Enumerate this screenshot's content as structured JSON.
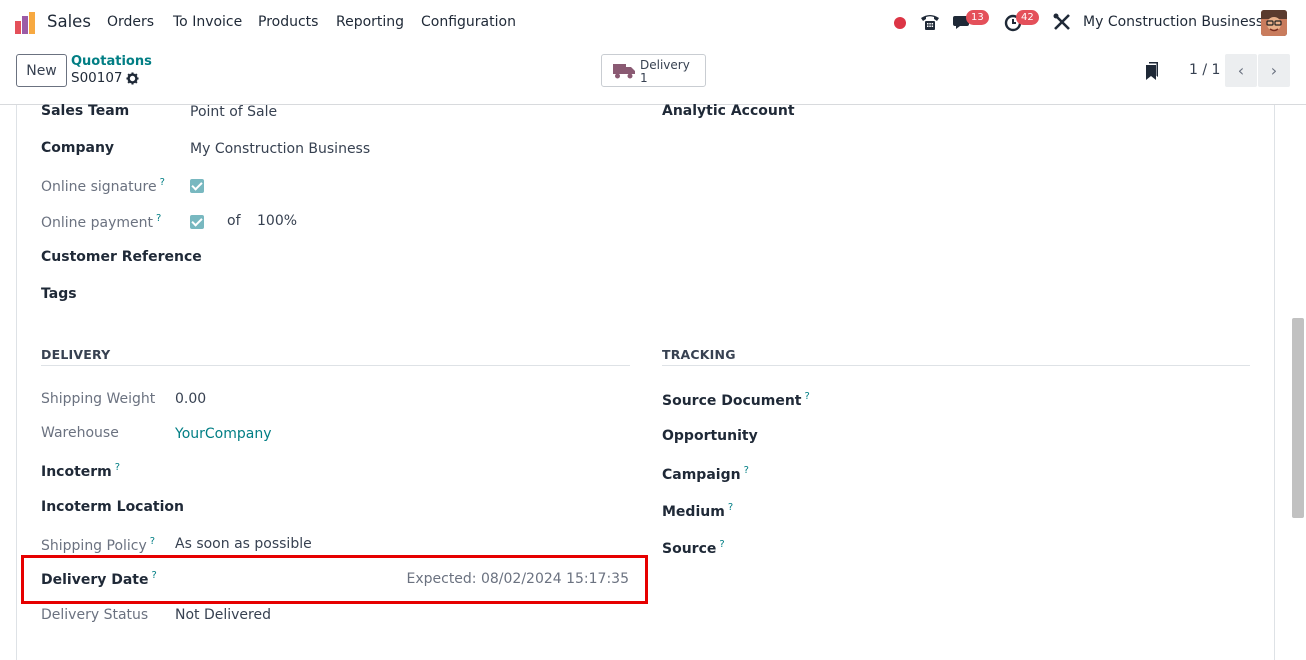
{
  "nav": {
    "app_name": "Sales",
    "menu": [
      "Orders",
      "To Invoice",
      "Products",
      "Reporting",
      "Configuration"
    ],
    "messages_badge": "13",
    "activities_badge": "42",
    "company": "My Construction Business"
  },
  "control": {
    "new_label": "New",
    "breadcrumb_parent": "Quotations",
    "record_name": "S00107",
    "smart_button_label": "Delivery",
    "smart_button_count": "1",
    "pager": "1 / 1"
  },
  "left_fields": {
    "sales_team_label": "Sales Team",
    "sales_team_value": "Point of Sale",
    "company_label": "Company",
    "company_value": "My Construction Business",
    "online_signature_label": "Online signature",
    "online_payment_label": "Online payment",
    "online_payment_of": "of",
    "online_payment_pct": "100%",
    "customer_reference_label": "Customer Reference",
    "tags_label": "Tags"
  },
  "right_fields": {
    "analytic_account_label": "Analytic Account"
  },
  "delivery": {
    "title": "DELIVERY",
    "shipping_weight_label": "Shipping Weight",
    "shipping_weight_value": "0.00",
    "warehouse_label": "Warehouse",
    "warehouse_value": "YourCompany",
    "incoterm_label": "Incoterm",
    "incoterm_location_label": "Incoterm Location",
    "shipping_policy_label": "Shipping Policy",
    "shipping_policy_value": "As soon as possible",
    "delivery_date_label": "Delivery Date",
    "delivery_date_value": "Expected: 08/02/2024 15:17:35",
    "delivery_status_label": "Delivery Status",
    "delivery_status_value": "Not Delivered"
  },
  "tracking": {
    "title": "TRACKING",
    "source_document_label": "Source Document",
    "opportunity_label": "Opportunity",
    "campaign_label": "Campaign",
    "medium_label": "Medium",
    "source_label": "Source"
  },
  "help_marker": "?",
  "colors": {
    "accent": "#017e84",
    "highlight": "#e60000",
    "badge": "#e4505a"
  }
}
